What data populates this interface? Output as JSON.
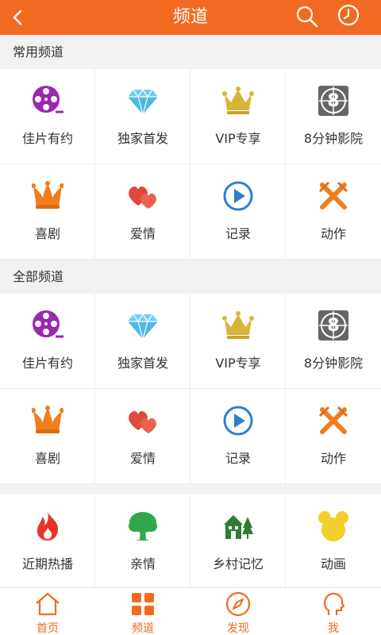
{
  "header": {
    "title": "频道"
  },
  "sections": [
    {
      "title": "常用频道"
    },
    {
      "title": "全部频道"
    }
  ],
  "channels": [
    {
      "label": "佳片有约",
      "icon": "film-reel-icon"
    },
    {
      "label": "独家首发",
      "icon": "diamond-icon"
    },
    {
      "label": "VIP专享",
      "icon": "crown-icon"
    },
    {
      "label": "8分钟影院",
      "icon": "countdown-8-icon"
    },
    {
      "label": "喜剧",
      "icon": "jester-hat-icon"
    },
    {
      "label": "爱情",
      "icon": "hearts-icon"
    },
    {
      "label": "记录",
      "icon": "play-circle-icon"
    },
    {
      "label": "动作",
      "icon": "crossed-swords-icon"
    }
  ],
  "more_channels": [
    {
      "label": "近期热播",
      "icon": "flame-icon"
    },
    {
      "label": "亲情",
      "icon": "tree-icon"
    },
    {
      "label": "乡村记忆",
      "icon": "village-house-icon"
    },
    {
      "label": "动画",
      "icon": "cartoon-head-icon"
    }
  ],
  "tabs": [
    {
      "label": "首页",
      "icon": "home-icon"
    },
    {
      "label": "频道",
      "icon": "grid-icon"
    },
    {
      "label": "发现",
      "icon": "compass-icon"
    },
    {
      "label": "我",
      "icon": "profile-head-icon"
    }
  ],
  "colors": {
    "accent": "#f26a21",
    "background": "#f2f2f2",
    "text": "#333333"
  }
}
